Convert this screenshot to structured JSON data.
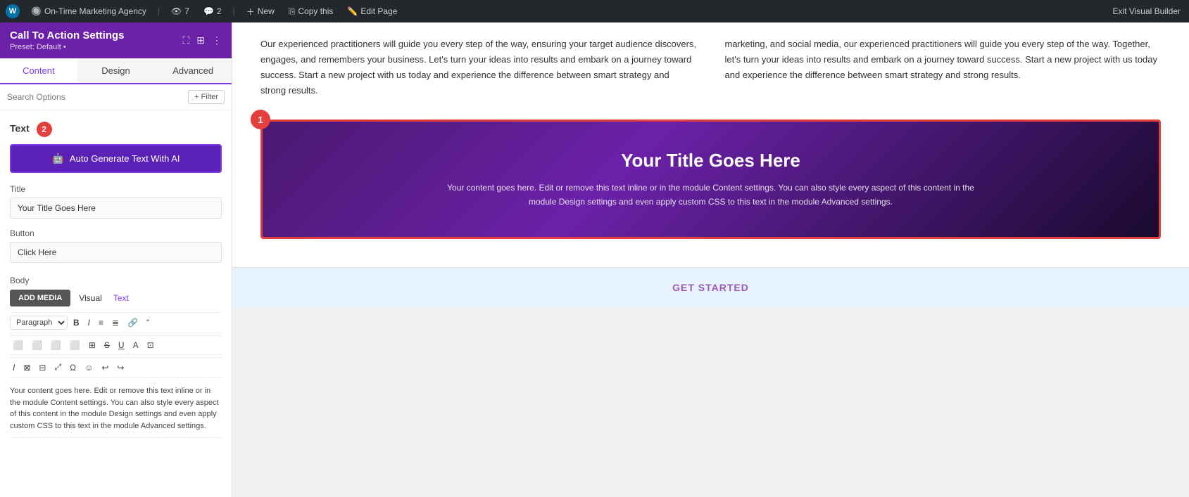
{
  "topbar": {
    "wp_label": "W",
    "agency": "On-Time Marketing Agency",
    "views": "7",
    "comments": "2",
    "new_label": "New",
    "copy_label": "Copy this",
    "edit_label": "Edit Page",
    "exit_label": "Exit Visual Builder"
  },
  "sidebar": {
    "title": "Call To Action Settings",
    "preset": "Preset: Default •",
    "tabs": [
      {
        "label": "Content",
        "id": "content"
      },
      {
        "label": "Design",
        "id": "design"
      },
      {
        "label": "Advanced",
        "id": "advanced"
      }
    ],
    "search_placeholder": "Search Options",
    "filter_label": "+ Filter",
    "text_section_label": "Text",
    "badge_number": "2",
    "ai_btn_label": "Auto Generate Text With AI",
    "title_label": "Title",
    "title_value": "Your Title Goes Here",
    "button_label": "Button",
    "button_value": "Click Here",
    "body_label": "Body",
    "add_media_label": "ADD MEDIA",
    "visual_label": "Visual",
    "text_tab_label": "Text",
    "paragraph_label": "Paragraph",
    "body_text": "Your content goes here. Edit or remove this text inline or in the module Content settings. You can also style every aspect of this content in the module Design settings and even apply custom CSS to this text in the module Advanced settings."
  },
  "main_content": {
    "col1_text": "Our experienced practitioners will guide you every step of the way, ensuring your target audience discovers, engages, and remembers your business. Let's turn your ideas into results and embark on a journey toward success. Start a new project with us today and experience the difference between smart strategy and strong results.",
    "col2_text": "marketing, and social media, our experienced practitioners will guide you every step of the way. Together, let's turn your ideas into results and embark on a journey toward success. Start a new project with us today and experience the difference between smart strategy and strong results.",
    "cta_number": "1",
    "cta_title": "Your Title Goes Here",
    "cta_body": "Your content goes here. Edit or remove this text inline or in the module Content settings. You can also style every aspect of this content in the module Design settings and even apply custom CSS to this text in the module Advanced settings.",
    "get_started_label": "GET STARTED"
  },
  "colors": {
    "sidebar_header_bg": "#6b21a8",
    "accent": "#7c3aed",
    "badge_red": "#e53e3e",
    "cta_border": "#e53e3e",
    "top_bar_bg": "#23282d"
  }
}
